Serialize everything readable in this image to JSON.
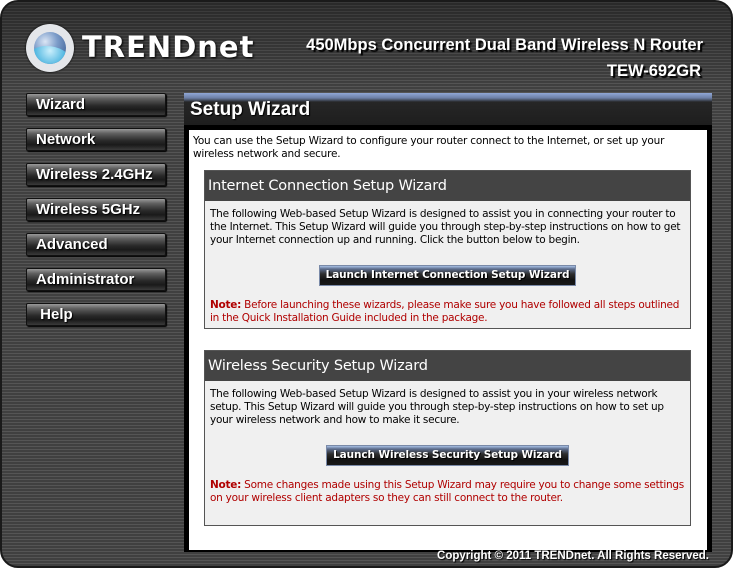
{
  "header": {
    "brand": "TRENDnet",
    "product_title": "450Mbps Concurrent Dual Band Wireless N Router",
    "model": "TEW-692GR"
  },
  "nav": {
    "items": [
      {
        "label": "Wizard"
      },
      {
        "label": "Network"
      },
      {
        "label": "Wireless 2.4GHz"
      },
      {
        "label": "Wireless 5GHz"
      },
      {
        "label": "Advanced"
      },
      {
        "label": "Administrator"
      },
      {
        "label": " Help"
      }
    ]
  },
  "main": {
    "title": "Setup Wizard",
    "intro": "You can use the Setup Wizard to configure your router connect to the Internet, or set up your wireless network and secure.",
    "sections": [
      {
        "title": "Internet Connection Setup Wizard",
        "description": "The following Web-based Setup Wizard is designed to assist you in connecting your router to the Internet. This Setup Wizard will guide you through step-by-step instructions on how to get your Internet connection up and running. Click the button below to begin.",
        "button_label": "Launch Internet Connection Setup Wizard",
        "note_label": "Note:",
        "note_text": " Before launching these wizards, please make sure you have followed all steps outlined in the Quick Installation Guide included in the package."
      },
      {
        "title": "Wireless Security Setup Wizard",
        "description": "The following Web-based Setup Wizard is designed to assist you in your wireless network setup. This Setup Wizard will guide you through step-by-step instructions on how to set up your wireless network and how to make it secure.",
        "button_label": "Launch Wireless Security Setup Wizard",
        "note_label": "Note:",
        "note_text": " Some changes made using this Setup Wizard may require you to change some settings on your wireless client adapters so they can still connect to the router."
      }
    ]
  },
  "footer": {
    "copyright": "Copyright © 2011 TRENDnet. All Rights Reserved."
  },
  "colors": {
    "note": "#b00000",
    "section_header": "#444444",
    "title_accent": "#8fa7d6"
  }
}
